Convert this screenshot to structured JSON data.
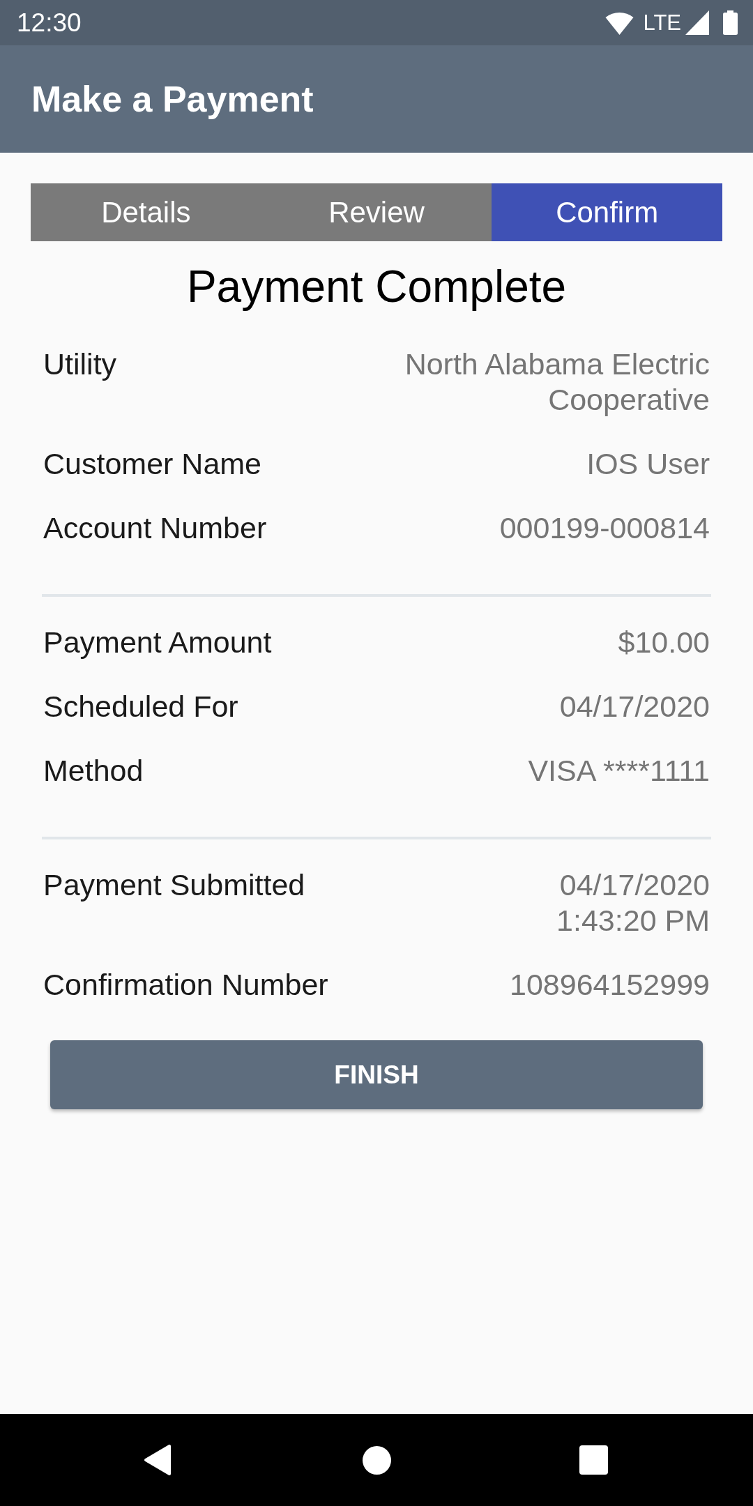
{
  "status_bar": {
    "time": "12:30",
    "network": "LTE"
  },
  "app_bar": {
    "title": "Make a Payment"
  },
  "steps": [
    {
      "label": "Details",
      "selected": false
    },
    {
      "label": "Review",
      "selected": false
    },
    {
      "label": "Confirm",
      "selected": true
    }
  ],
  "heading": "Payment Complete",
  "sections": [
    {
      "rows": [
        {
          "label": "Utility",
          "value": "North Alabama Electric Cooperative"
        },
        {
          "label": "Customer Name",
          "value": "IOS User"
        },
        {
          "label": "Account Number",
          "value": "000199-000814"
        }
      ]
    },
    {
      "rows": [
        {
          "label": "Payment Amount",
          "value": "$10.00"
        },
        {
          "label": "Scheduled For",
          "value": "04/17/2020"
        },
        {
          "label": "Method",
          "value": "VISA ****1111"
        }
      ]
    },
    {
      "rows": [
        {
          "label": "Payment Submitted",
          "value": "04/17/2020\n1:43:20 PM"
        },
        {
          "label": "Confirmation Number",
          "value": "108964152999"
        }
      ]
    }
  ],
  "finish_button": {
    "label": "FINISH"
  }
}
